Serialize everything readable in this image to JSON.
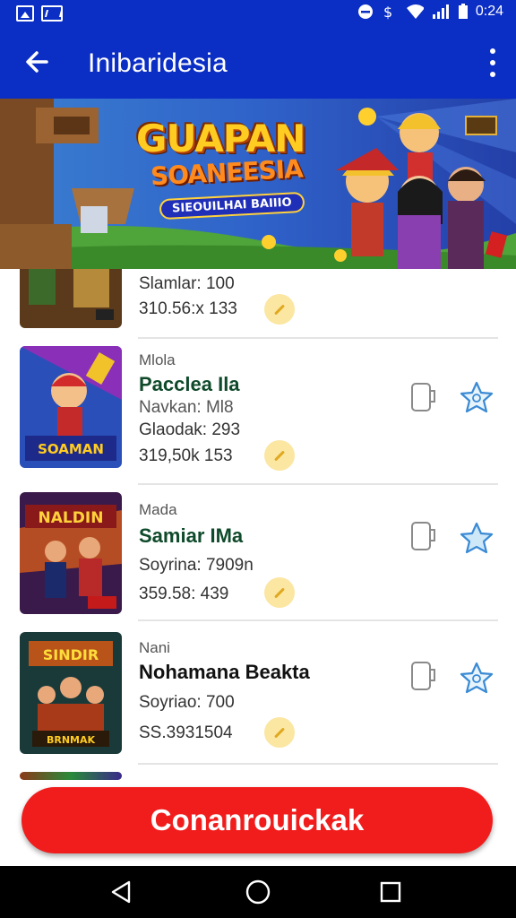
{
  "status_bar": {
    "time": "0:24"
  },
  "app_bar": {
    "title": "Inibaridesia"
  },
  "banner": {
    "headline": "GUAPAN",
    "subheadline": "SOANEESIA",
    "ribbon": "SIEOUILHAI BAIIIO"
  },
  "games": [
    {
      "category": "",
      "name": "",
      "stat1": "Slamlar: 100",
      "stat2": "310.56:x 133",
      "thumb_text": ""
    },
    {
      "category": "Mlola",
      "name": "Pacclea Ila",
      "stat0": "Navkan: Ml8",
      "stat1": "Glaodak: 293",
      "stat2": "319,50k 153",
      "thumb_text": "SOAMAN"
    },
    {
      "category": "Mada",
      "name": "Samiar IMa",
      "stat1": "Soyrina: 7909n",
      "stat2": "359.58: 439",
      "thumb_text": "NALDIN"
    },
    {
      "category": "Nani",
      "name": "Nohamana Beakta",
      "stat1": "Soyriao: 700",
      "stat2": "SS.3931504",
      "thumb_text": "SINDIR"
    }
  ],
  "cta": {
    "label": "Conanrouickak"
  },
  "colors": {
    "primary": "#0b2ec4",
    "cta": "#f11d1d",
    "name_green": "#0f4a2a"
  },
  "icons": [
    "back-arrow-icon",
    "more-vertical-icon",
    "phone-icon",
    "star-icon",
    "coin-icon",
    "nav-back-icon",
    "nav-home-icon",
    "nav-recents-icon"
  ]
}
